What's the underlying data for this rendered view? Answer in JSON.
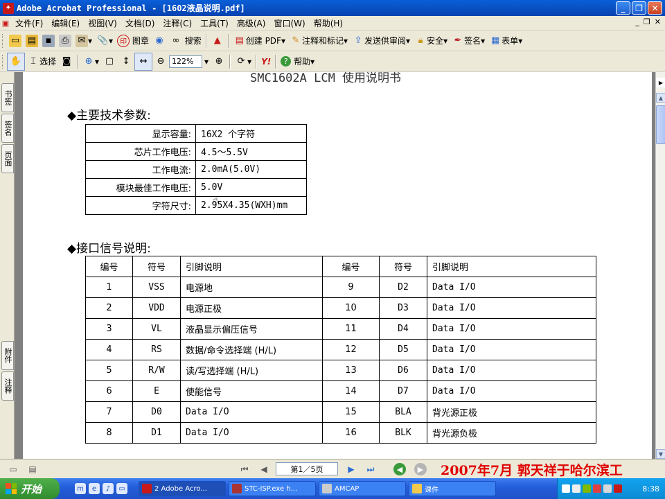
{
  "window": {
    "title": "Adobe Acrobat Professional - [1602液晶说明.pdf]",
    "app_icon": "acrobat-icon"
  },
  "menu": [
    "文件(F)",
    "编辑(E)",
    "视图(V)",
    "文档(D)",
    "注释(C)",
    "工具(T)",
    "高级(A)",
    "窗口(W)",
    "帮助(H)"
  ],
  "toolbar1": {
    "stamp": "图章",
    "search": "搜索",
    "create_pdf": "创建 PDF",
    "comment": "注释和标记",
    "send_review": "发送供审阅",
    "secure": "安全",
    "sign": "签名",
    "forms": "表单"
  },
  "toolbar2": {
    "select": "选择",
    "zoom": "122%",
    "help": "帮助",
    "yahoo": "Y!"
  },
  "left_tabs": [
    "书签",
    "签名",
    "页面",
    "附件",
    "注释"
  ],
  "document": {
    "title_partial": "SMC1602A LCM  使用说明书",
    "section1": "◆主要技术参数:",
    "section2": "◆接口信号说明:",
    "specs": [
      {
        "k": "显示容量:",
        "v": "16X2 个字符"
      },
      {
        "k": "芯片工作电压:",
        "v": "4.5～5.5V"
      },
      {
        "k": "工作电流:",
        "v": "2.0mA(5.0V)"
      },
      {
        "k": "模块最佳工作电压:",
        "v": "5.0V"
      },
      {
        "k": "字符尺寸:",
        "v": "2.95X4.35(WXH)mm"
      }
    ],
    "pin_headers": [
      "编号",
      "符号",
      "引脚说明",
      "编号",
      "符号",
      "引脚说明"
    ],
    "pins": [
      [
        "1",
        "VSS",
        "电源地",
        "9",
        "D2",
        "Data I/O"
      ],
      [
        "2",
        "VDD",
        "电源正极",
        "10",
        "D3",
        "Data I/O"
      ],
      [
        "3",
        "VL",
        "液晶显示偏压信号",
        "11",
        "D4",
        "Data I/O"
      ],
      [
        "4",
        "RS",
        "数据/命令选择端 (H/L)",
        "12",
        "D5",
        "Data I/O"
      ],
      [
        "5",
        "R/W",
        "读/写选择端 (H/L)",
        "13",
        "D6",
        "Data I/O"
      ],
      [
        "6",
        "E",
        "使能信号",
        "14",
        "D7",
        "Data I/O"
      ],
      [
        "7",
        "D0",
        "Data I/O",
        "15",
        "BLA",
        "背光源正极"
      ],
      [
        "8",
        "D1",
        "Data I/O",
        "16",
        "BLK",
        "背光源负极"
      ]
    ]
  },
  "status": {
    "page": "第1／5页",
    "watermark": "2007年7月  郭天祥于哈尔滨工"
  },
  "taskbar": {
    "start": "开始",
    "tasks": [
      "2 Adobe Acro...",
      "STC-ISP.exe h...",
      "AMCAP",
      "课件"
    ],
    "clock": "8:38"
  },
  "colors": {
    "titlebar": "#0a5fd8",
    "watermark": "#e00000",
    "taskbar": "#245edb",
    "start": "#318b2e"
  }
}
